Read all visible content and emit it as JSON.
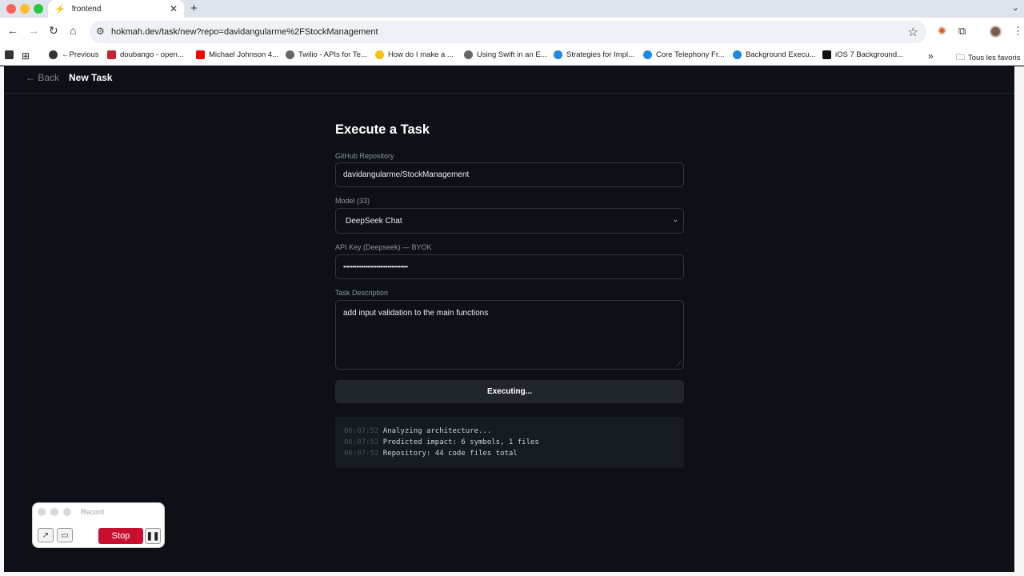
{
  "browser": {
    "tab_title": "frontend",
    "tab_favicon": "bolt-icon",
    "url": "hokmah.dev/task/new?repo=davidangularme%2FStockManagement",
    "bookmarks": [
      {
        "label": "Previous",
        "prefix": "← "
      },
      {
        "label": "doubango - open..."
      },
      {
        "label": "Michael Johnson 4..."
      },
      {
        "label": "Twilio - APIs for Te..."
      },
      {
        "label": "How do I make a ..."
      },
      {
        "label": "Using Swift in an E..."
      },
      {
        "label": "Strategies for Impl..."
      },
      {
        "label": "Core Telephony Fr..."
      },
      {
        "label": "Background Execu..."
      },
      {
        "label": "iOS 7 Background..."
      }
    ],
    "bookmarks_more": "»",
    "all_bookmarks": "Tous les favoris"
  },
  "header": {
    "back_label": "← Back",
    "title": "New Task"
  },
  "form": {
    "heading": "Execute a Task",
    "repo_label": "GitHub Repository",
    "repo_value": "davidangularme/StockManagement",
    "model_label": "Model (33)",
    "model_value": "DeepSeek Chat",
    "apikey_label": "API Key (Deepseek) — BYOK",
    "apikey_value": "•••••••••••••••••••••••••••••••••••",
    "task_label": "Task Description",
    "task_value": "add input validation to the main functions",
    "execute_label": "Executing..."
  },
  "log": [
    {
      "time": "06:07:52",
      "msg": "Analyzing architecture..."
    },
    {
      "time": "06:07:52",
      "msg": "Predicted impact: 6 symbols, 1 files"
    },
    {
      "time": "06:07:52",
      "msg": "Repository: 44 code files total"
    }
  ],
  "recorder": {
    "title": "Record",
    "stop_label": "Stop"
  },
  "colors": {
    "page_bg": "#0d1117",
    "accent_red": "#c8102e"
  }
}
